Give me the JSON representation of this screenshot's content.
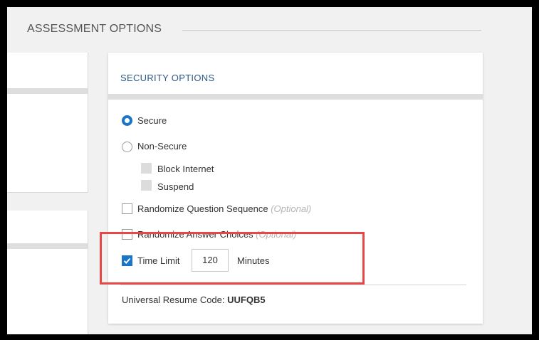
{
  "section": {
    "title": "ASSESSMENT OPTIONS"
  },
  "security": {
    "title": "SECURITY OPTIONS",
    "secure_label": "Secure",
    "nonsecure_label": "Non-Secure",
    "block_internet_label": "Block Internet",
    "suspend_label": "Suspend",
    "randomize_question_label": "Randomize Question Sequence",
    "randomize_answer_label": "Randomize Answer Choices",
    "optional_label": "(Optional)",
    "time_limit_label": "Time Limit",
    "time_limit_value": "120",
    "minutes_label": "Minutes",
    "resume_code_label": "Universal Resume Code:",
    "resume_code_value": "UUFQB5"
  },
  "colors": {
    "accent": "#1a74c8",
    "title_blue": "#2e5a88",
    "highlight_red": "#e64848"
  },
  "state": {
    "secure_selected": true,
    "nonsecure_selected": false,
    "randomize_question_checked": false,
    "randomize_answer_checked": false,
    "time_limit_checked": true
  }
}
